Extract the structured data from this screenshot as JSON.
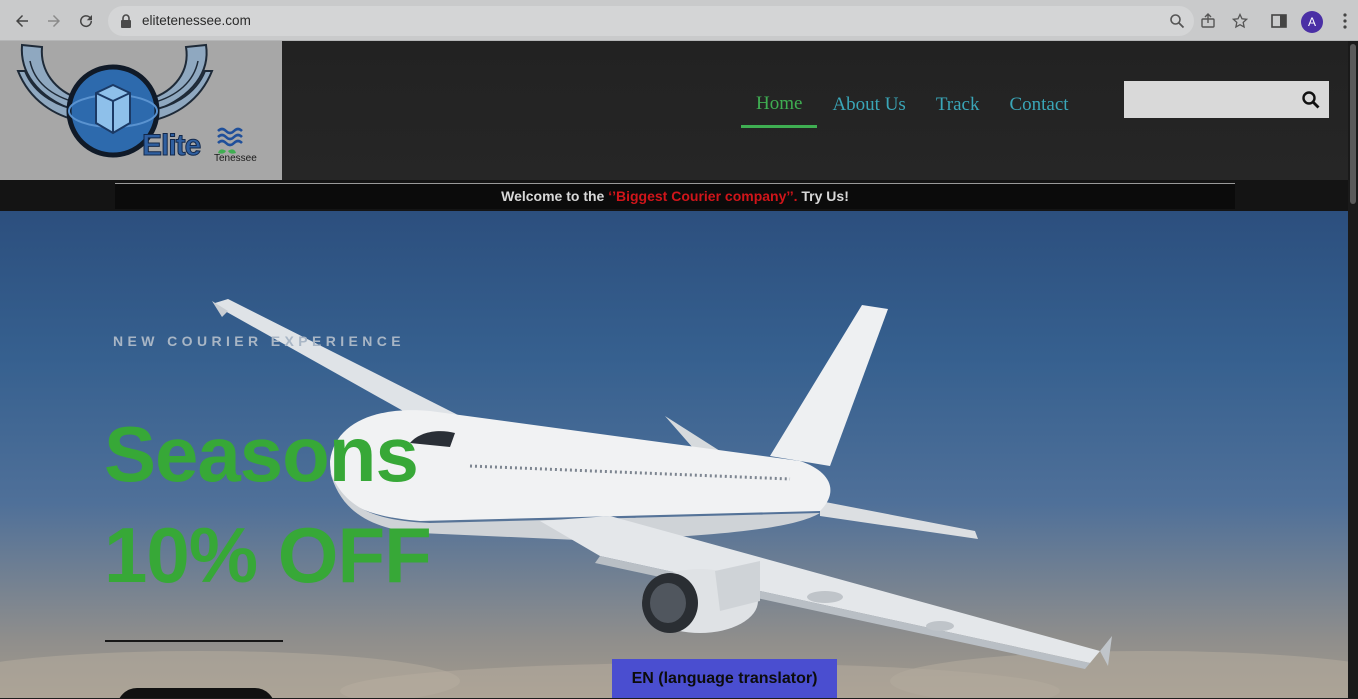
{
  "browser": {
    "url": "elitetenessee.com",
    "profile_initial": "A"
  },
  "logo": {
    "word": "Elite",
    "sub": "Tenessee"
  },
  "nav": {
    "items": [
      {
        "label": "Home",
        "active": true
      },
      {
        "label": "About Us",
        "active": false
      },
      {
        "label": "Track",
        "active": false
      },
      {
        "label": "Contact",
        "active": false
      }
    ]
  },
  "search": {
    "placeholder": ""
  },
  "announcement": {
    "prefix": "Welcome to the ",
    "highlight": "‘’Biggest Courier company’’.",
    "suffix": " Try Us!"
  },
  "hero": {
    "tagline": "NEW COURIER EXPERIENCE",
    "title_line1": "Seasons",
    "title_line2": "10% OFF"
  },
  "language_button": {
    "label": "EN (language translator)"
  },
  "colors": {
    "accent_green": "#37a837",
    "nav_teal": "#3aa6b8",
    "announcement_red": "#d0151a",
    "language_button_bg": "#4a4ed0"
  },
  "icons": {
    "back": "arrow-left-icon",
    "forward": "arrow-right-icon",
    "reload": "reload-icon",
    "lock": "lock-icon",
    "zoom": "magnifier-icon",
    "share": "share-icon",
    "bookmark": "star-icon",
    "side_panel": "side-panel-icon",
    "menu": "kebab-menu-icon",
    "search": "search-icon"
  }
}
